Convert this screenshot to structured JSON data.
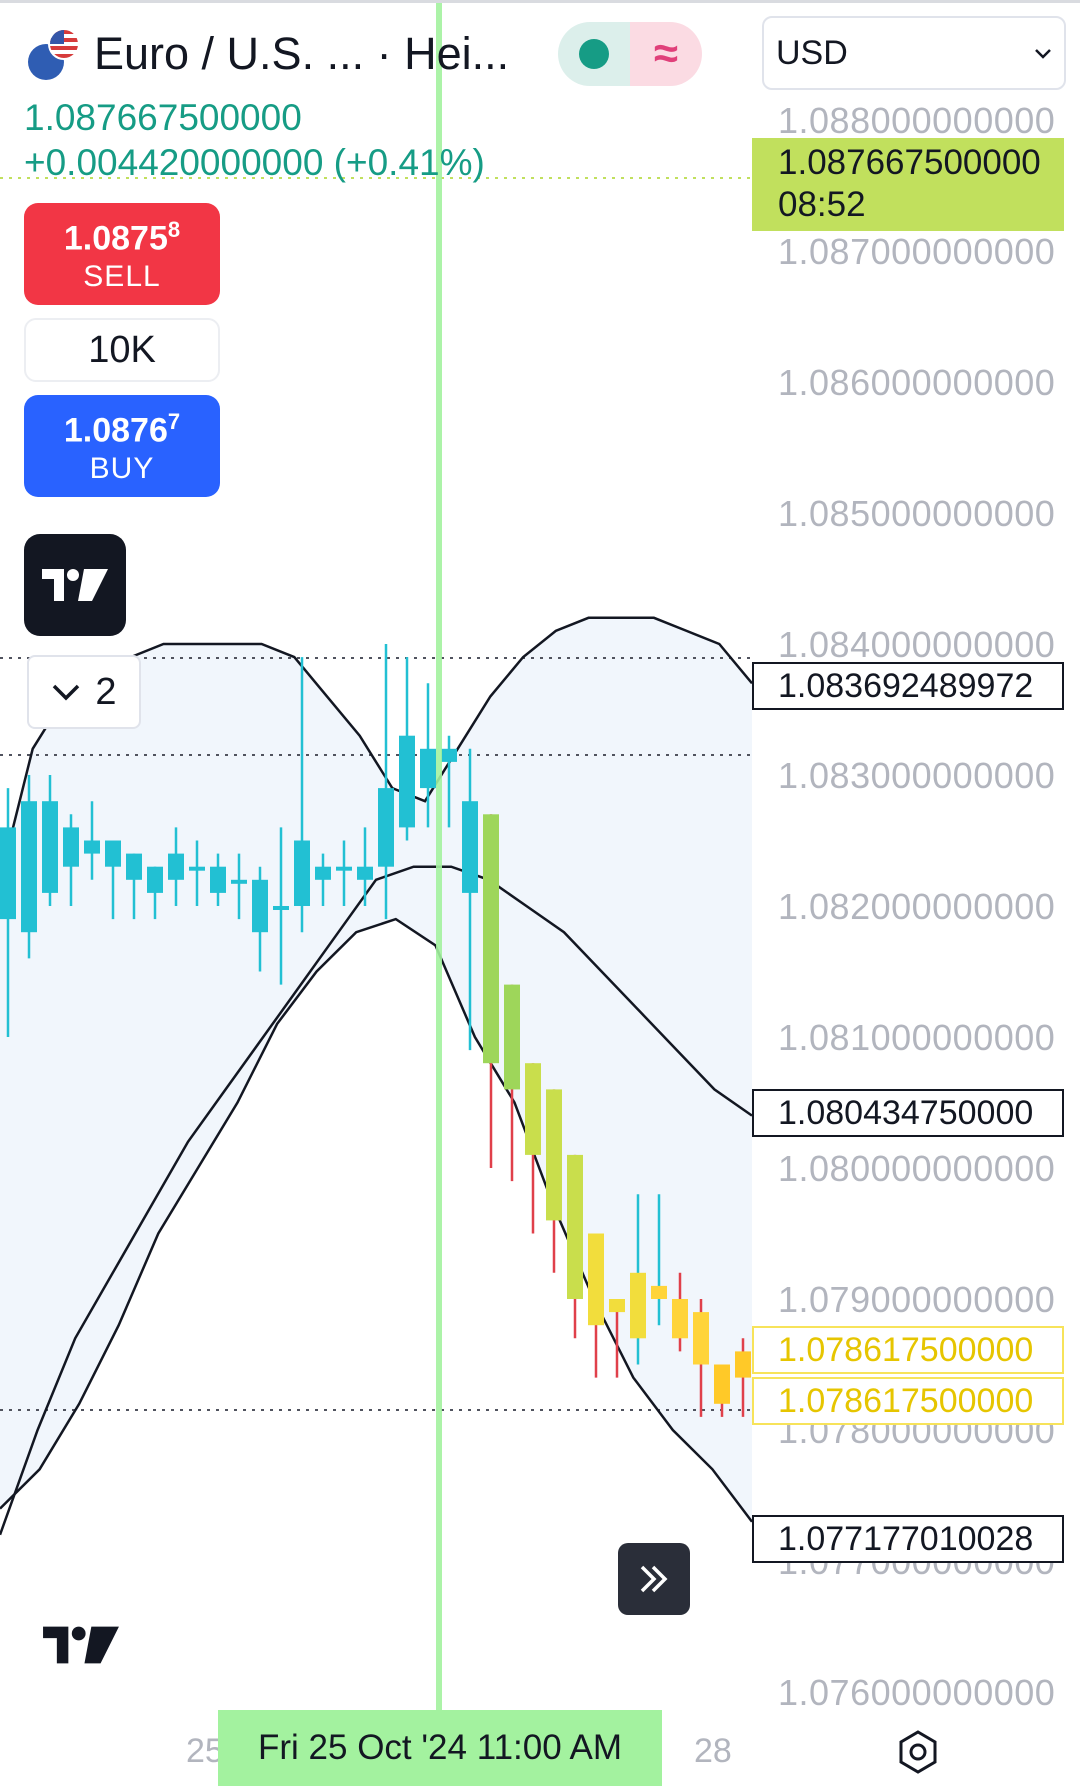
{
  "header": {
    "symbol_title": "Euro / U.S. ...  · Hei...",
    "last_price": "1.087667500000",
    "change": "+0.004420000000 (+0.41%)",
    "currency": "USD",
    "market_status": "open",
    "status_symbol": "≈"
  },
  "trade": {
    "sell_main": "1.0875",
    "sell_sup": "8",
    "sell_label": "SELL",
    "quantity": "10K",
    "buy_main": "1.0876",
    "buy_sup": "7",
    "buy_label": "BUY"
  },
  "indicators": {
    "collapsed_count": "2"
  },
  "price_axis": {
    "ticks": [
      "1.088000000000",
      "1.087000000000",
      "1.086000000000",
      "1.085000000000",
      "1.084000000000",
      "1.083000000000",
      "1.082000000000",
      "1.081000000000",
      "1.080000000000",
      "1.079000000000",
      "1.078000000000",
      "1.077000000000",
      "1.076000000000"
    ],
    "last_price_label": "1.087667500000",
    "countdown": "08:52",
    "bb_upper_label": "1.083692489972",
    "bb_basis_label": "1.080434750000",
    "close_label_1": "1.078617500000",
    "close_label_2": "1.078617500000",
    "bb_lower_label": "1.077177010028"
  },
  "time_axis": {
    "left_label": "25",
    "right_label": "28",
    "crosshair_label": "Fri 25 Oct '24   11:00 AM"
  },
  "colors": {
    "up": "#22c0d3",
    "down_gradient": [
      "#9ed65a",
      "#c9de4c",
      "#f2dd3c",
      "#ffd43a",
      "#ffc928"
    ],
    "crosshair": "#a3f29f",
    "band_fill": "#f1f6fc"
  },
  "chart_data": {
    "type": "candlestick",
    "style": "Heikin Ashi",
    "bollinger": true,
    "y_range": [
      1.0755,
      1.0882
    ],
    "candles": [
      {
        "o": 1.0819,
        "h": 1.0829,
        "l": 1.081,
        "c": 1.0826
      },
      {
        "o": 1.0818,
        "h": 1.083,
        "l": 1.0816,
        "c": 1.0828
      },
      {
        "o": 1.0821,
        "h": 1.083,
        "l": 1.082,
        "c": 1.0828
      },
      {
        "o": 1.0823,
        "h": 1.0827,
        "l": 1.082,
        "c": 1.0826
      },
      {
        "o": 1.0824,
        "h": 1.0828,
        "l": 1.0822,
        "c": 1.0825
      },
      {
        "o": 1.0823,
        "h": 1.0825,
        "l": 1.0819,
        "c": 1.0825
      },
      {
        "o": 1.0822,
        "h": 1.0824,
        "l": 1.0819,
        "c": 1.0824
      },
      {
        "o": 1.0821,
        "h": 1.0823,
        "l": 1.0819,
        "c": 1.0823
      },
      {
        "o": 1.0822,
        "h": 1.0826,
        "l": 1.082,
        "c": 1.0824
      },
      {
        "o": 1.0823,
        "h": 1.0825,
        "l": 1.082,
        "c": 1.0823
      },
      {
        "o": 1.0821,
        "h": 1.0824,
        "l": 1.082,
        "c": 1.0823
      },
      {
        "o": 1.0822,
        "h": 1.0824,
        "l": 1.0819,
        "c": 1.0822
      },
      {
        "o": 1.0818,
        "h": 1.0823,
        "l": 1.0815,
        "c": 1.0822
      },
      {
        "o": 1.082,
        "h": 1.0826,
        "l": 1.0814,
        "c": 1.082
      },
      {
        "o": 1.082,
        "h": 1.0839,
        "l": 1.0818,
        "c": 1.0825
      },
      {
        "o": 1.0822,
        "h": 1.0824,
        "l": 1.082,
        "c": 1.0823
      },
      {
        "o": 1.0823,
        "h": 1.0825,
        "l": 1.082,
        "c": 1.0823
      },
      {
        "o": 1.0822,
        "h": 1.0826,
        "l": 1.082,
        "c": 1.0823
      },
      {
        "o": 1.0823,
        "h": 1.084,
        "l": 1.0819,
        "c": 1.0829
      },
      {
        "o": 1.0826,
        "h": 1.0839,
        "l": 1.0825,
        "c": 1.0833
      },
      {
        "o": 1.0829,
        "h": 1.0837,
        "l": 1.0826,
        "c": 1.0832
      },
      {
        "o": 1.0831,
        "h": 1.0833,
        "l": 1.0826,
        "c": 1.0832
      },
      {
        "o": 1.0821,
        "h": 1.0832,
        "l": 1.0809,
        "c": 1.0828
      },
      {
        "o": 1.0827,
        "h": 1.0827,
        "l": 1.08,
        "c": 1.0808
      },
      {
        "o": 1.0814,
        "h": 1.0814,
        "l": 1.0799,
        "c": 1.0806
      },
      {
        "o": 1.0808,
        "h": 1.0808,
        "l": 1.0795,
        "c": 1.0801
      },
      {
        "o": 1.0806,
        "h": 1.0806,
        "l": 1.0792,
        "c": 1.0796
      },
      {
        "o": 1.0801,
        "h": 1.0801,
        "l": 1.0787,
        "c": 1.079
      },
      {
        "o": 1.0795,
        "h": 1.0795,
        "l": 1.0784,
        "c": 1.0788
      },
      {
        "o": 1.079,
        "h": 1.079,
        "l": 1.0784,
        "c": 1.0789
      },
      {
        "o": 1.0787,
        "h": 1.0798,
        "l": 1.0785,
        "c": 1.0792
      },
      {
        "o": 1.079,
        "h": 1.0798,
        "l": 1.0788,
        "c": 1.0791
      },
      {
        "o": 1.079,
        "h": 1.0792,
        "l": 1.0786,
        "c": 1.0787
      },
      {
        "o": 1.0789,
        "h": 1.079,
        "l": 1.0781,
        "c": 1.0785
      },
      {
        "o": 1.0785,
        "h": 1.0785,
        "l": 1.0781,
        "c": 1.0782
      },
      {
        "o": 1.0784,
        "h": 1.0787,
        "l": 1.0781,
        "c": 1.0786
      }
    ],
    "bb_upper": [
      1.0822,
      1.0832,
      1.0836,
      1.0838,
      1.0839,
      1.084,
      1.084,
      1.084,
      1.084,
      1.0839,
      1.0836,
      1.0833,
      1.0829,
      1.0828,
      1.0832,
      1.0836,
      1.0839,
      1.0841,
      1.0842,
      1.0842,
      1.0842,
      1.0841,
      1.084,
      1.0837
    ],
    "bb_basis": [
      1.0772,
      1.078,
      1.0787,
      1.0792,
      1.0797,
      1.0802,
      1.0806,
      1.081,
      1.0814,
      1.0818,
      1.0822,
      1.0823,
      1.0823,
      1.0822,
      1.082,
      1.0818,
      1.0815,
      1.0812,
      1.0809,
      1.0806,
      1.0804
    ],
    "bb_lower": [
      1.0774,
      1.0777,
      1.0782,
      1.0788,
      1.0795,
      1.08,
      1.0805,
      1.0811,
      1.0815,
      1.0818,
      1.0819,
      1.0817,
      1.081,
      1.0805,
      1.0797,
      1.079,
      1.0784,
      1.078,
      1.0777,
      1.0773
    ]
  }
}
